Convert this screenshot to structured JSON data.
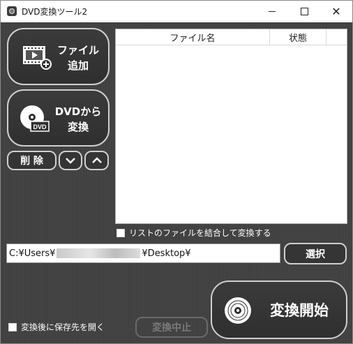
{
  "window": {
    "title": "DVD変換ツール2"
  },
  "buttons": {
    "add_file": "ファイル\n追加",
    "add_file_line1": "ファイル",
    "add_file_line2": "追加",
    "from_dvd_line1": "DVDから",
    "from_dvd_line2": "変換",
    "delete": "削 除",
    "select": "選択",
    "start": "変換開始",
    "stop": "変換中止",
    "dvd_badge": "DVD"
  },
  "list": {
    "columns": [
      "ファイル名",
      "状態"
    ],
    "rows": []
  },
  "options": {
    "merge_label": "リストのファイルを結合して変換する",
    "open_after_label": "変換後に保存先を開く"
  },
  "output": {
    "path_prefix": "C:¥Users¥",
    "path_suffix": "¥Desktop¥"
  },
  "colors": {
    "background": "#424242",
    "button_border": "#cfcfcf",
    "accent_text": "#ffffff"
  },
  "icons": {
    "add_file": "film-plus-icon",
    "dvd": "disc-icon",
    "move_down": "chevron-down-icon",
    "move_up": "chevron-up-icon",
    "start": "disc-icon"
  }
}
